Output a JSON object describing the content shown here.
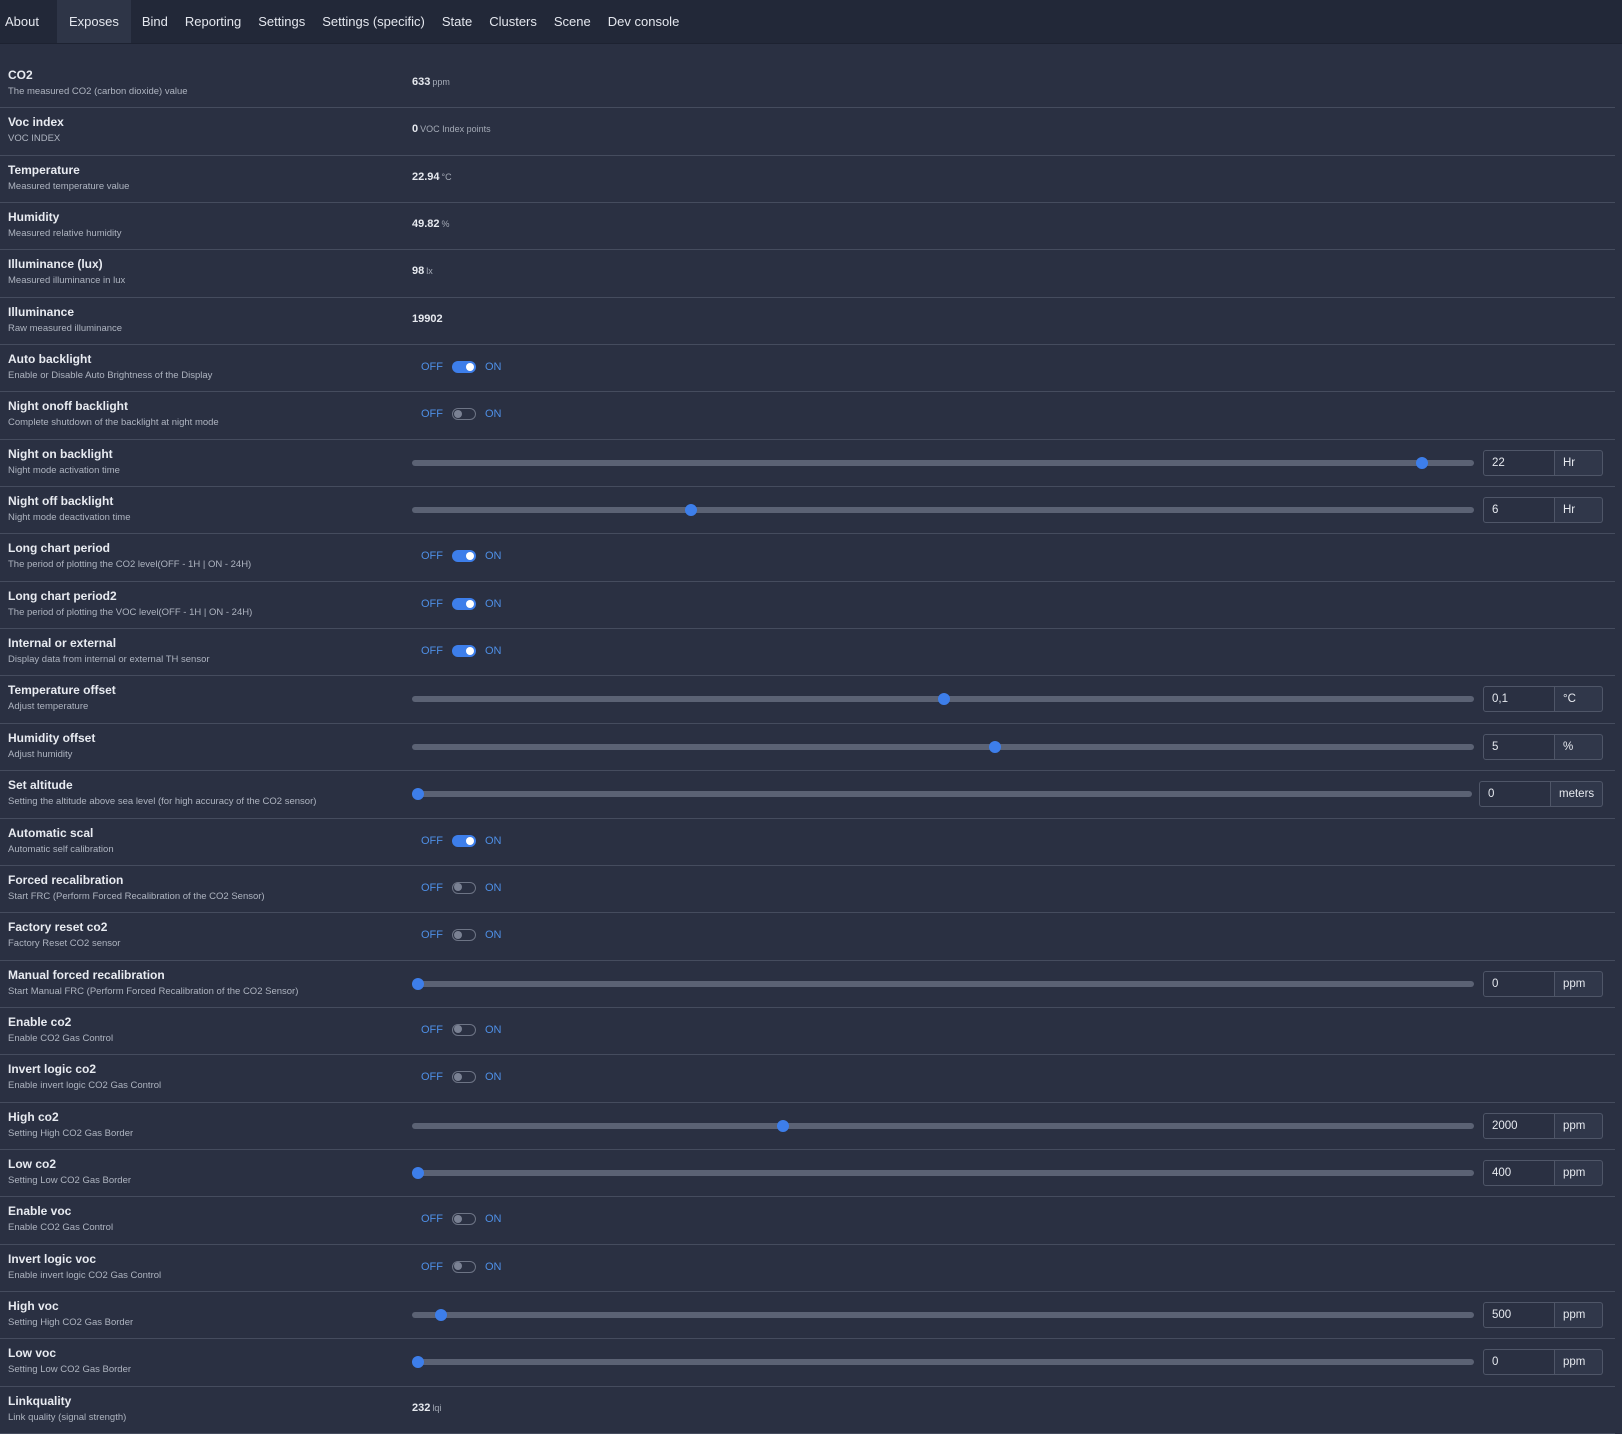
{
  "tabs": [
    {
      "label": "About",
      "active": false
    },
    {
      "label": "Exposes",
      "active": true
    },
    {
      "label": "Bind",
      "active": false
    },
    {
      "label": "Reporting",
      "active": false
    },
    {
      "label": "Settings",
      "active": false
    },
    {
      "label": "Settings (specific)",
      "active": false
    },
    {
      "label": "State",
      "active": false
    },
    {
      "label": "Clusters",
      "active": false
    },
    {
      "label": "Scene",
      "active": false
    },
    {
      "label": "Dev console",
      "active": false
    }
  ],
  "switch_labels": {
    "off": "OFF",
    "on": "ON"
  },
  "colors": {
    "accent": "#3d7eea",
    "background": "#2a3042",
    "tabbar": "#222838"
  },
  "rows": [
    {
      "kind": "value",
      "title": "CO2",
      "desc": "The measured CO2 (carbon dioxide) value",
      "value": "633",
      "unit": "ppm"
    },
    {
      "kind": "value",
      "title": "Voc index",
      "desc": "VOC INDEX",
      "value": "0",
      "unit": "VOC Index points"
    },
    {
      "kind": "value",
      "title": "Temperature",
      "desc": "Measured temperature value",
      "value": "22.94",
      "unit": "°C"
    },
    {
      "kind": "value",
      "title": "Humidity",
      "desc": "Measured relative humidity",
      "value": "49.82",
      "unit": "%"
    },
    {
      "kind": "value",
      "title": "Illuminance (lux)",
      "desc": "Measured illuminance in lux",
      "value": "98",
      "unit": "lx"
    },
    {
      "kind": "value",
      "title": "Illuminance",
      "desc": "Raw measured illuminance",
      "value": "19902",
      "unit": ""
    },
    {
      "kind": "switch",
      "title": "Auto backlight",
      "desc": "Enable or Disable Auto Brightness of the Display",
      "on": true
    },
    {
      "kind": "switch",
      "title": "Night onoff backlight",
      "desc": "Complete shutdown of the backlight at night mode",
      "on": false
    },
    {
      "kind": "slider",
      "title": "Night on backlight",
      "desc": "Night mode activation time",
      "value": "22",
      "unit": "Hr",
      "level": 0.951
    },
    {
      "kind": "slider",
      "title": "Night off backlight",
      "desc": "Night mode deactivation time",
      "value": "6",
      "unit": "Hr",
      "level": 0.263
    },
    {
      "kind": "switch",
      "title": "Long chart period",
      "desc": "The period of plotting the CO2 level(OFF - 1H | ON - 24H)",
      "on": true
    },
    {
      "kind": "switch",
      "title": "Long chart period2",
      "desc": "The period of plotting the VOC level(OFF - 1H | ON - 24H)",
      "on": true
    },
    {
      "kind": "switch",
      "title": "Internal or external",
      "desc": "Display data from internal or external TH sensor",
      "on": true
    },
    {
      "kind": "slider",
      "title": "Temperature offset",
      "desc": "Adjust temperature",
      "value": "0,1",
      "unit": "°C",
      "level": 0.501
    },
    {
      "kind": "slider",
      "title": "Humidity offset",
      "desc": "Adjust humidity",
      "value": "5",
      "unit": "%",
      "level": 0.549
    },
    {
      "kind": "slider",
      "title": "Set altitude",
      "desc": "Setting the altitude above sea level (for high accuracy of the CO2 sensor)",
      "value": "0",
      "unit": "meters",
      "level": 0.006
    },
    {
      "kind": "switch",
      "title": "Automatic scal",
      "desc": "Automatic self calibration",
      "on": true
    },
    {
      "kind": "switch",
      "title": "Forced recalibration",
      "desc": "Start FRC (Perform Forced Recalibration of the CO2 Sensor)",
      "on": false
    },
    {
      "kind": "switch",
      "title": "Factory reset co2",
      "desc": "Factory Reset CO2 sensor",
      "on": false
    },
    {
      "kind": "slider",
      "title": "Manual forced recalibration",
      "desc": "Start Manual FRC (Perform Forced Recalibration of the CO2 Sensor)",
      "value": "0",
      "unit": "ppm",
      "level": 0.006
    },
    {
      "kind": "switch",
      "title": "Enable co2",
      "desc": "Enable CO2 Gas Control",
      "on": false
    },
    {
      "kind": "switch",
      "title": "Invert logic co2",
      "desc": "Enable invert logic CO2 Gas Control",
      "on": false
    },
    {
      "kind": "slider",
      "title": "High co2",
      "desc": "Setting High CO2 Gas Border",
      "value": "2000",
      "unit": "ppm",
      "level": 0.349
    },
    {
      "kind": "slider",
      "title": "Low co2",
      "desc": "Setting Low CO2 Gas Border",
      "value": "400",
      "unit": "ppm",
      "level": 0.006
    },
    {
      "kind": "switch",
      "title": "Enable voc",
      "desc": "Enable CO2 Gas Control",
      "on": false
    },
    {
      "kind": "switch",
      "title": "Invert logic voc",
      "desc": "Enable invert logic CO2 Gas Control",
      "on": false
    },
    {
      "kind": "slider",
      "title": "High voc",
      "desc": "Setting High CO2 Gas Border",
      "value": "500",
      "unit": "ppm",
      "level": 0.027
    },
    {
      "kind": "slider",
      "title": "Low voc",
      "desc": "Setting Low CO2 Gas Border",
      "value": "0",
      "unit": "ppm",
      "level": 0.006
    },
    {
      "kind": "value",
      "title": "Linkquality",
      "desc": "Link quality (signal strength)",
      "value": "232",
      "unit": "lqi"
    }
  ]
}
